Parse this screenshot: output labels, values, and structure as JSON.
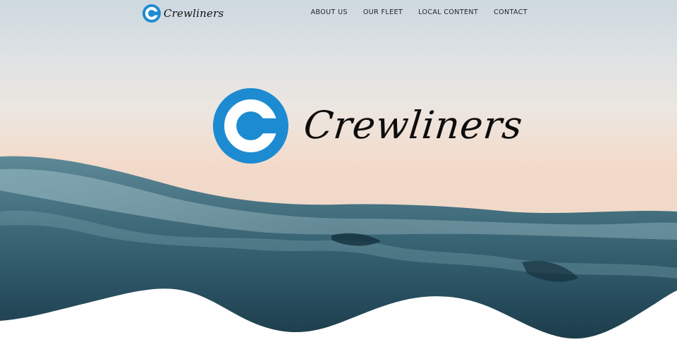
{
  "brand": {
    "name": "Crewliners",
    "accent": "#1d8bd1"
  },
  "nav": {
    "items": [
      {
        "label": "ABOUT US"
      },
      {
        "label": "OUR FLEET"
      },
      {
        "label": "LOCAL CONTENT"
      },
      {
        "label": "CONTACT"
      }
    ]
  },
  "colors": {
    "sky_top": "#cdd8df",
    "sky_horizon": "#f3dccd",
    "sea_dark": "#1e3c4a",
    "sea_light": "#6f9aa8"
  }
}
